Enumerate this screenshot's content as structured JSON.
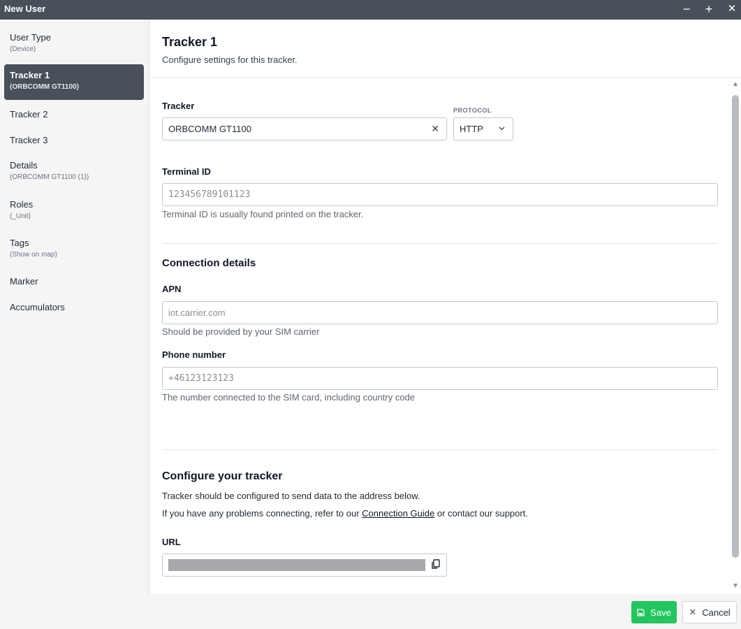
{
  "window": {
    "title": "New User",
    "controls": {
      "minimize": "−",
      "maximize": "+",
      "close": "✕"
    }
  },
  "sidebar": {
    "items": [
      {
        "label": "User Type",
        "sub": "(Device)"
      },
      {
        "label": "Tracker 1",
        "sub": "(ORBCOMM GT1100)"
      },
      {
        "label": "Tracker 2",
        "sub": ""
      },
      {
        "label": "Tracker 3",
        "sub": ""
      },
      {
        "label": "Details",
        "sub": "(ORBCOMM GT1100 (1))"
      },
      {
        "label": "Roles",
        "sub": "(_Unit)"
      },
      {
        "label": "Tags",
        "sub": "(Show on map)"
      },
      {
        "label": "Marker",
        "sub": ""
      },
      {
        "label": "Accumulators",
        "sub": ""
      }
    ],
    "active_index": 1
  },
  "main": {
    "title": "Tracker 1",
    "subtitle": "Configure settings for this tracker.",
    "tracker": {
      "label": "Tracker",
      "value": "ORBCOMM GT1100",
      "clear_icon": "close-icon"
    },
    "protocol": {
      "label": "PROTOCOL",
      "value": "HTTP"
    },
    "terminal_id": {
      "label": "Terminal ID",
      "placeholder": "123456789101123",
      "helper": "Terminal ID is usually found printed on the tracker."
    },
    "connection": {
      "title": "Connection details",
      "apn": {
        "label": "APN",
        "placeholder": "iot.carrier.com",
        "helper": "Should be provided by your SIM carrier"
      },
      "phone": {
        "label": "Phone number",
        "placeholder": "+46123123123",
        "helper": "The number connected to the SIM card, including country code"
      }
    },
    "configure": {
      "title": "Configure your tracker",
      "line1": "Tracker should be configured to send data to the address below.",
      "line2_before": "If you have any problems connecting, refer to our ",
      "line2_link": "Connection Guide",
      "line2_after": " or contact our support.",
      "url_label": "URL",
      "copy_icon": "copy-icon"
    }
  },
  "footer": {
    "save_label": "Save",
    "cancel_label": "Cancel"
  },
  "colors": {
    "titlebar": "#48505a",
    "active_nav": "#48505a",
    "save_button": "#22c55e"
  }
}
